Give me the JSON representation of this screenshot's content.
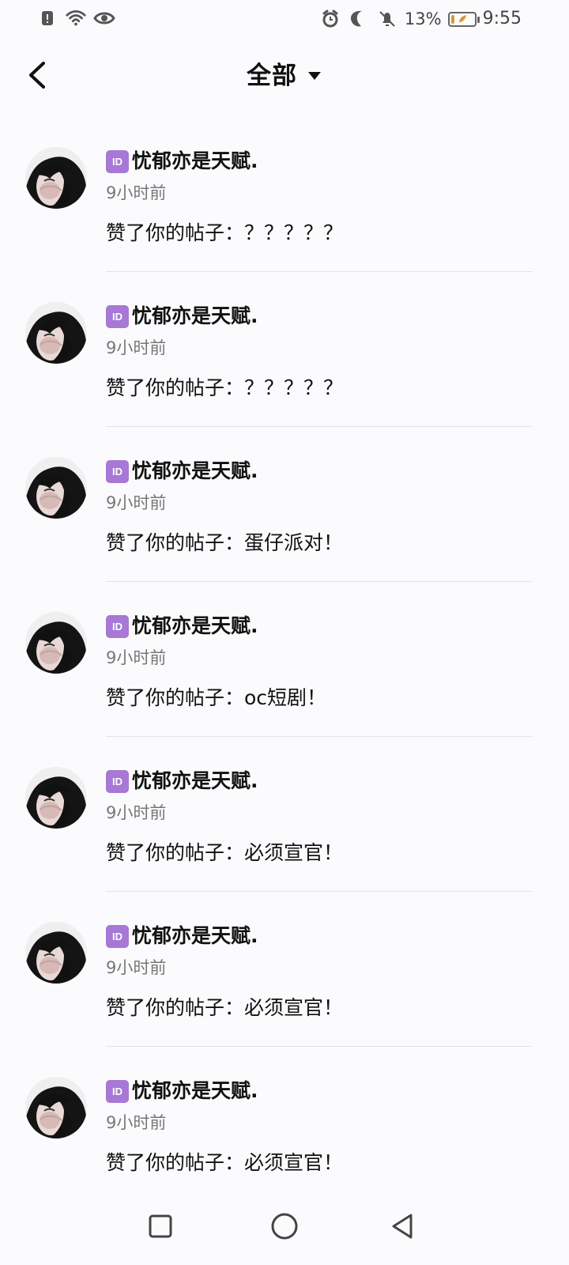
{
  "status_bar": {
    "left_icons": [
      "alert-icon",
      "wifi-icon",
      "eye-icon"
    ],
    "right_icons": [
      "alarm-icon",
      "moon-icon",
      "muted-bell-icon",
      "battery-icon"
    ],
    "battery_percent_text": "13%",
    "battery_level": 0.13,
    "time": "9:55",
    "battery_accent": "#d39b35"
  },
  "header": {
    "title": "全部",
    "dropdown_icon": "triangle-down-icon",
    "back_icon": "chevron-left-icon"
  },
  "notifications": [
    {
      "badge": "ID",
      "username": "忧郁亦是天赋.",
      "time": "9小时前",
      "message": "赞了你的帖子：？？？？？"
    },
    {
      "badge": "ID",
      "username": "忧郁亦是天赋.",
      "time": "9小时前",
      "message": "赞了你的帖子：？？？？？"
    },
    {
      "badge": "ID",
      "username": "忧郁亦是天赋.",
      "time": "9小时前",
      "message": "赞了你的帖子：蛋仔派对！"
    },
    {
      "badge": "ID",
      "username": "忧郁亦是天赋.",
      "time": "9小时前",
      "message": "赞了你的帖子：oc短剧！"
    },
    {
      "badge": "ID",
      "username": "忧郁亦是天赋.",
      "time": "9小时前",
      "message": "赞了你的帖子：必须宣官！"
    },
    {
      "badge": "ID",
      "username": "忧郁亦是天赋.",
      "time": "9小时前",
      "message": "赞了你的帖子：必须宣官！"
    },
    {
      "badge": "ID",
      "username": "忧郁亦是天赋.",
      "time": "9小时前",
      "message": "赞了你的帖子：必须宣官！"
    }
  ],
  "bottom_nav": {
    "icons": [
      "square-icon",
      "circle-icon",
      "triangle-back-icon"
    ]
  },
  "colors": {
    "background": "#fbfbfd",
    "badge": "#a778d6",
    "separator": "#e4e4e8",
    "text": "#111111",
    "secondary_text": "#777777"
  }
}
